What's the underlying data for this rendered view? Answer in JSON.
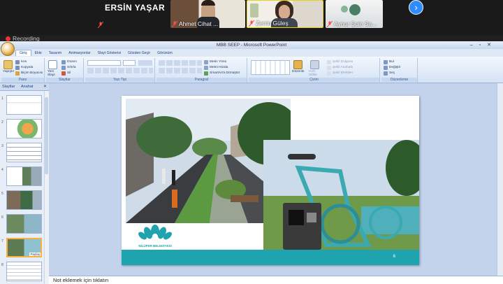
{
  "zoom_call": {
    "presenter_name": "ERSİN YAŞAR",
    "participants": [
      {
        "name": "Ahmet Cihat ..."
      },
      {
        "name": "Zerrin Güleş"
      },
      {
        "name": "Aynur Şule Sa..."
      }
    ],
    "recording_label": "Recording"
  },
  "powerpoint": {
    "window_title": "MBB SEEP - Microsoft PowerPoint",
    "ribbon_tabs": [
      "Giriş",
      "Ekle",
      "Tasarım",
      "Animasyonlar",
      "Slayt Gösterisi",
      "Gözden Geçir",
      "Görünüm"
    ],
    "active_tab": "Giriş",
    "groups": {
      "pano": {
        "label": "Pano",
        "paste": "Yapıştır",
        "cut": "Kes",
        "copy": "Kopyala",
        "format_painter": "Biçim Boyacısı"
      },
      "slaytlar": {
        "label": "Slaytlar",
        "new_slide": "Yeni Slayt",
        "layout": "Düzen",
        "reset": "Sıfırla",
        "delete": "Sil"
      },
      "yazi_tipi": {
        "label": "Yazı Tipi"
      },
      "paragraf": {
        "label": "Paragraf",
        "text_direction": "Metin Yönü",
        "align_text": "Metni Hizala",
        "smartart": "SmartArt'a Dönüştür"
      },
      "cizim": {
        "label": "Çizim",
        "arrange": "Düzenle",
        "quick_styles": "Hızlı Stiller",
        "shape_fill": "Şekil Dolgusu",
        "shape_outline": "Şekil Anahattı",
        "shape_effects": "Şekil Efektleri"
      },
      "duzenleme": {
        "label": "Düzenleme",
        "find": "Bul",
        "replace": "Değiştir",
        "select": "Seç"
      }
    },
    "pane_tabs": [
      "Slaytlar",
      "Anahat"
    ],
    "thumbnails": [
      "1",
      "2",
      "3",
      "4",
      "5",
      "6",
      "7",
      "8"
    ],
    "selected_thumbnail": "7",
    "thumbnail_overlay_label": "Paylaş",
    "slide": {
      "logo_text": "NİLÜFER BELEDİYESİ",
      "page_number": "6",
      "band_color": "#1fa3ae"
    },
    "notes_placeholder": "Not eklemek için tıklatın"
  },
  "icons": [
    "microphone-muted-icon",
    "next-page-arrow-icon",
    "office-logo-icon",
    "close-pane-icon"
  ]
}
